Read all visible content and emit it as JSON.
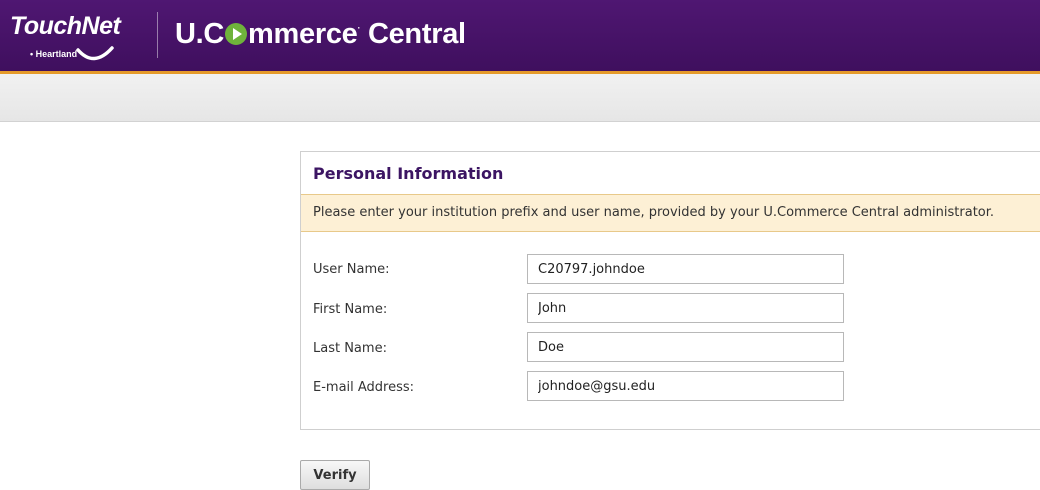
{
  "header": {
    "logo_text": "TouchNet",
    "logo_sub": "• Heartland",
    "brand_part1": "U.C",
    "brand_part2": "mmerce",
    "brand_part3": " Central",
    "brand_sup": "·",
    "colors": {
      "header_bg": "#4f1772",
      "accent_line": "#e59a2a",
      "play_icon": "#6fb33b"
    }
  },
  "panel": {
    "title": "Personal Information",
    "notice": "Please enter your institution prefix and user name, provided by your U.Commerce Central administrator.",
    "fields": [
      {
        "label": "User Name:",
        "value": "C20797.johndoe"
      },
      {
        "label": "First Name:",
        "value": "John"
      },
      {
        "label": "Last Name:",
        "value": "Doe"
      },
      {
        "label": "E-mail Address:",
        "value": "johndoe@gsu.edu"
      }
    ]
  },
  "actions": {
    "verify_label": "Verify"
  }
}
